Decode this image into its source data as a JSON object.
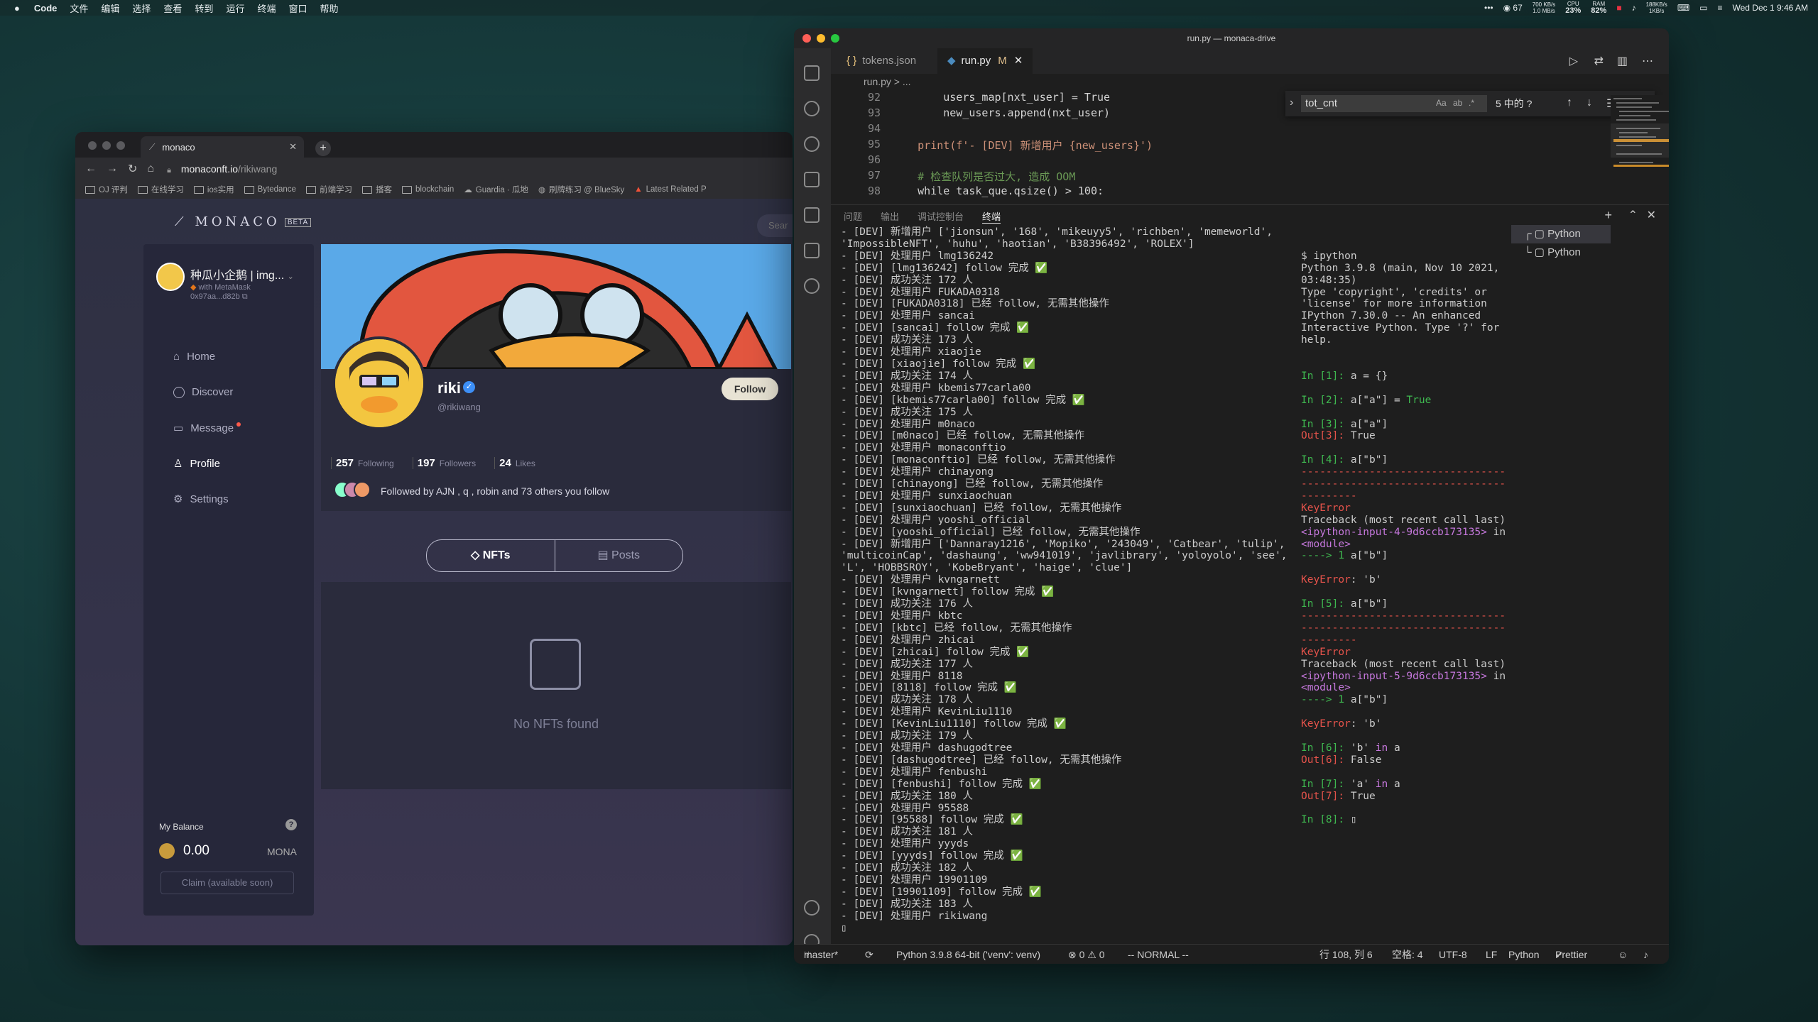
{
  "menubar": {
    "app": "Code",
    "items": [
      "文件",
      "编辑",
      "选择",
      "查看",
      "转到",
      "运行",
      "终端",
      "窗口",
      "帮助"
    ],
    "wechat_count": "67",
    "net_up": "700 KB/s",
    "net_down": "1.0 MB/s",
    "cpu_label": "CPU",
    "cpu": "23%",
    "ram_label": "RAM",
    "ram": "82%",
    "disk_up": "188KB/s",
    "disk_down": "1KB/s",
    "datetime": "Wed Dec 1  9:46 AM"
  },
  "browser": {
    "tab_title": "monaco",
    "url_host": "monaconft.io",
    "url_path": "/rikiwang",
    "bookmarks": [
      "OJ 评判",
      "在线学习",
      "ios实用",
      "Bytedance",
      "前端学习",
      "播客",
      "blockchain",
      "Guardia · 瓜地",
      "刷牌练习 @ BlueSky",
      "Latest Related P"
    ]
  },
  "site": {
    "logo": "MONACO",
    "beta": "BETA",
    "search_placeholder": "Sear",
    "account": {
      "name": "种瓜小企鹅 | img...",
      "via": "with MetaMask",
      "address": "0x97aa...d82b"
    },
    "nav": [
      "Home",
      "Discover",
      "Message",
      "Profile",
      "Settings"
    ],
    "balance": {
      "label": "My Balance",
      "help": "?",
      "amount": "0.00",
      "unit": "MONA",
      "claim": "Claim (available soon)"
    },
    "profile": {
      "name": "riki",
      "handle": "@rikiwang",
      "follow": "Follow",
      "following_count": "257",
      "following_label": "Following",
      "followers_count": "197",
      "followers_label": "Followers",
      "likes_count": "24",
      "likes_label": "Likes",
      "followed_by": "Followed by AJN , q , robin and 73 others you follow"
    },
    "tabs": [
      "NFTs",
      "Posts"
    ],
    "empty": "No NFTs found"
  },
  "vscode": {
    "title": "run.py — monaca-drive",
    "tabs": [
      {
        "label": "tokens.json",
        "icon": "{ }"
      },
      {
        "label": "run.py",
        "mod": "M"
      }
    ],
    "breadcrumb": "run.py  >  ...",
    "find_value": "tot_cnt",
    "find_count": "5 中的 ?",
    "lines": [
      {
        "n": "92",
        "t": "        users_map[nxt_user] = True"
      },
      {
        "n": "93",
        "t": "        new_users.append(nxt_user)"
      },
      {
        "n": "94",
        "t": ""
      },
      {
        "n": "95",
        "t": "    print(f'- [DEV] 新增用户 {new_users}')"
      },
      {
        "n": "96",
        "t": ""
      },
      {
        "n": "97",
        "t": "    # 检查队列是否过大, 造成 OOM"
      },
      {
        "n": "98",
        "t": "    while task_que.qsize() > 100:"
      }
    ],
    "panel_tabs": [
      "问题",
      "输出",
      "调试控制台",
      "终端"
    ],
    "terminal": "- [DEV] 新增用户 ['jionsun', '168', 'mikeuyy5', 'richben', 'memeworld', 'ImpossibleNFT', 'huhu', 'haotian', 'B38396492', 'ROLEX']\n- [DEV] 处理用户 lmg136242\n- [DEV] [lmg136242] follow 完成 ✅\n- [DEV] 成功关注 172 人\n- [DEV] 处理用户 FUKADA0318\n- [DEV] [FUKADA0318] 已经 follow, 无需其他操作\n- [DEV] 处理用户 sancai\n- [DEV] [sancai] follow 完成 ✅\n- [DEV] 成功关注 173 人\n- [DEV] 处理用户 xiaojie\n- [DEV] [xiaojie] follow 完成 ✅\n- [DEV] 成功关注 174 人\n- [DEV] 处理用户 kbemis77carla00\n- [DEV] [kbemis77carla00] follow 完成 ✅\n- [DEV] 成功关注 175 人\n- [DEV] 处理用户 m0naco\n- [DEV] [m0naco] 已经 follow, 无需其他操作\n- [DEV] 处理用户 monaconftio\n- [DEV] [monaconftio] 已经 follow, 无需其他操作\n- [DEV] 处理用户 chinayong\n- [DEV] [chinayong] 已经 follow, 无需其他操作\n- [DEV] 处理用户 sunxiaochuan\n- [DEV] [sunxiaochuan] 已经 follow, 无需其他操作\n- [DEV] 处理用户 yooshi_official\n- [DEV] [yooshi_official] 已经 follow, 无需其他操作\n- [DEV] 新增用户 ['Dannaray1216', 'Mopiko', '243049', 'Catbear', 'tulip', 'multicoinCap', 'dashaung', 'ww941019', 'javlibrary', 'yoloyolo', 'see', 'L', 'HOBBSROY', 'KobeBryant', 'haige', 'clue']\n- [DEV] 处理用户 kvngarnett\n- [DEV] [kvngarnett] follow 完成 ✅\n- [DEV] 成功关注 176 人\n- [DEV] 处理用户 kbtc\n- [DEV] [kbtc] 已经 follow, 无需其他操作\n- [DEV] 处理用户 zhicai\n- [DEV] [zhicai] follow 完成 ✅\n- [DEV] 成功关注 177 人\n- [DEV] 处理用户 8118\n- [DEV] [8118] follow 完成 ✅\n- [DEV] 成功关注 178 人\n- [DEV] 处理用户 KevinLiu1110\n- [DEV] [KevinLiu1110] follow 完成 ✅\n- [DEV] 成功关注 179 人\n- [DEV] 处理用户 dashugodtree\n- [DEV] [dashugodtree] 已经 follow, 无需其他操作\n- [DEV] 处理用户 fenbushi\n- [DEV] [fenbushi] follow 完成 ✅\n- [DEV] 成功关注 180 人\n- [DEV] 处理用户 95588\n- [DEV] [95588] follow 完成 ✅\n- [DEV] 成功关注 181 人\n- [DEV] 处理用户 yyyds\n- [DEV] [yyyds] follow 完成 ✅\n- [DEV] 成功关注 182 人\n- [DEV] 处理用户 19901109\n- [DEV] [19901109] follow 完成 ✅\n- [DEV] 成功关注 183 人\n- [DEV] 处理用户 rikiwang\n▯",
    "ipython_header": "$ ipython\nPython 3.9.8 (main, Nov 10 2021, 03:48:35)\nType 'copyright', 'credits' or 'license' for more information\nIPython 7.30.0 -- An enhanced Interactive Python. Type '?' for help.",
    "terminal_list": [
      "Python",
      "Python"
    ],
    "status": {
      "branch": "master*",
      "interpreter": "Python 3.9.8 64-bit ('venv': venv)",
      "problems": "⊗ 0 ⚠ 0",
      "mode": "-- NORMAL --",
      "position": "行 108, 列 6",
      "spaces": "空格: 4",
      "encoding": "UTF-8",
      "eol": "LF",
      "language": "Python",
      "formatter": "Prettier"
    }
  }
}
